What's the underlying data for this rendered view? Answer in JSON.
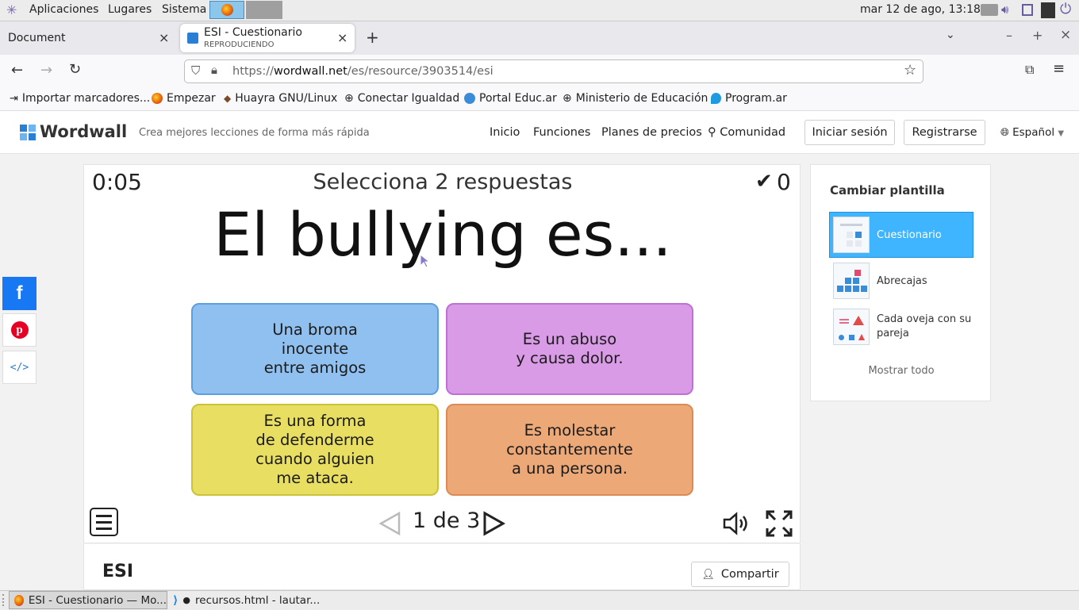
{
  "system_panel": {
    "menus": [
      "Aplicaciones",
      "Lugares",
      "Sistema"
    ],
    "datetime": "mar 12 de ago, 13:18"
  },
  "browser": {
    "tabs": [
      {
        "title": "Document",
        "subtitle": ""
      },
      {
        "title": "ESI - Cuestionario",
        "subtitle": "REPRODUCIENDO"
      }
    ],
    "url": {
      "scheme": "https://",
      "host": "wordwall.net",
      "path": "/es/resource/3903514/esi"
    },
    "bookmarks": [
      "Importar marcadores...",
      "Empezar",
      "Huayra GNU/Linux",
      "Conectar Igualdad",
      "Portal Educ.ar",
      "Ministerio de Educación",
      "Program.ar"
    ]
  },
  "site": {
    "logo": "Wordwall",
    "tagline": "Crea mejores lecciones de forma más rápida",
    "nav": [
      "Inicio",
      "Funciones",
      "Planes de precios",
      "Comunidad"
    ],
    "login": "Iniciar sesión",
    "register": "Registrarse",
    "language": "Español"
  },
  "game": {
    "timer": "0:05",
    "instruction": "Selecciona 2 respuestas",
    "score": "0",
    "question": "El bullying es...",
    "answers": [
      {
        "text": "Una broma\ninocente\nentre amigos",
        "color": "#8fc0f0",
        "border": "#5b9fe0"
      },
      {
        "text": "Es un abuso\ny causa dolor.",
        "color": "#d99ae6",
        "border": "#bf6fd6"
      },
      {
        "text": "Es una forma\nde defenderme\ncuando alguien\nme ataca.",
        "color": "#e8df62",
        "border": "#ccc238"
      },
      {
        "text": "Es molestar\nconstantemente\na una persona.",
        "color": "#eda878",
        "border": "#dd8a55"
      }
    ],
    "pager": "1 de 3"
  },
  "activity": {
    "title": "ESI",
    "share": "Compartir"
  },
  "templates": {
    "heading": "Cambiar plantilla",
    "items": [
      "Cuestionario",
      "Abrecajas",
      "Cada oveja con su pareja"
    ],
    "active_index": 0,
    "show_all": "Mostrar todo",
    "active_color": "#3fb4ff"
  },
  "taskbar": {
    "items": [
      "ESI - Cuestionario — Mo...",
      "recursos.html - lautar..."
    ]
  }
}
